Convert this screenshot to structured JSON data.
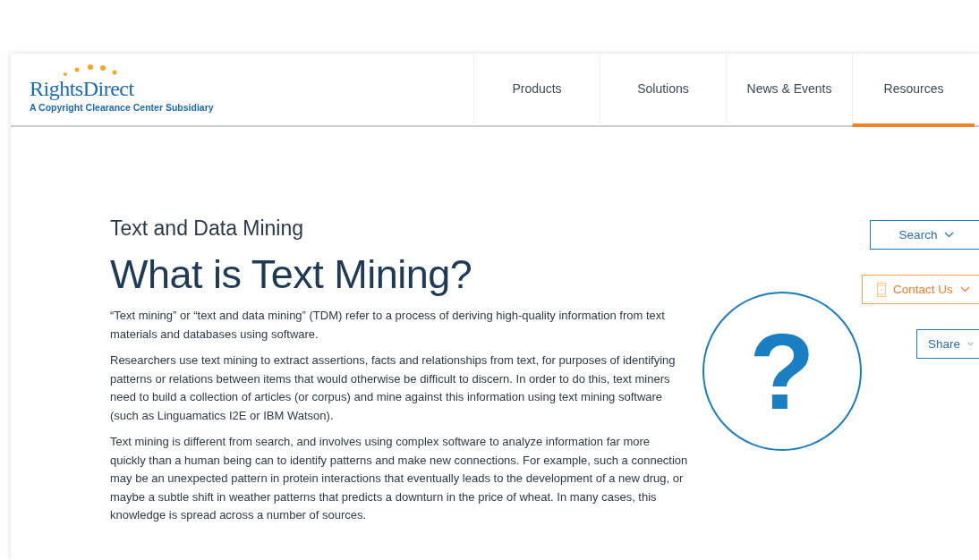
{
  "logo": {
    "name": "RightsDirect",
    "tagline": "A Copyright Clearance Center Subsidiary"
  },
  "nav": [
    {
      "label": "Products",
      "selected": false
    },
    {
      "label": "Solutions",
      "selected": false
    },
    {
      "label": "News & Events",
      "selected": false
    },
    {
      "label": "Resources",
      "selected": true
    }
  ],
  "article": {
    "section": "Text and Data Mining",
    "title": "What is Text Mining?",
    "paragraphs": [
      "“Text mining” or “text and data mining” (TDM) refer to a process of deriving high-quality information from text materials and databases using software.",
      "Researchers use text mining to extract assertions, facts and relationships from text, for purposes of identifying patterns or relations between items that would otherwise be difficult to discern. In order to do this, text miners need to build a collection of articles (or corpus) and mine against this information using text mining software (such as Linguamatics I2E or IBM Watson).",
      "Text mining is different from search, and involves using complex software to analyze information far more quickly than a human being can to identify patterns and make new connections. For example, such a connection may be an unexpected pattern in protein interactions that eventually leads to the development of a new drug, or maybe a subtle shift in weather patterns that predicts a downturn in the price of wheat. In many cases, this knowledge is spread across a number of sources."
    ]
  },
  "illustration": {
    "symbol": "?"
  },
  "actions": [
    {
      "label": "Search",
      "kind": "wide"
    },
    {
      "label": "Contact Us",
      "kind": "contact"
    },
    {
      "label": "Share",
      "kind": "compact"
    }
  ]
}
